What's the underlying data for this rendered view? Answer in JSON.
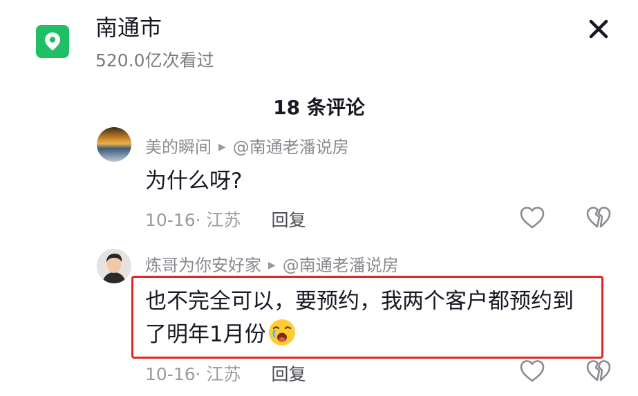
{
  "header": {
    "title": "南通市",
    "views": "520.0亿次看过"
  },
  "comments_count": "18 条评论",
  "comments": [
    {
      "author": "美的瞬间",
      "reply_to": "@南通老潘说房",
      "text": "为什么呀?",
      "date": "10-16· 江苏",
      "reply_label": "回复"
    },
    {
      "author": "炼哥为你安好家",
      "reply_to": "@南通老潘说房",
      "text": "也不完全可以，要预约，我两个客户都预约到了明年1月份",
      "date": "10-16· 江苏",
      "reply_label": "回复"
    }
  ],
  "icons": {
    "location": "location-pin-icon",
    "close": "close-icon",
    "like": "heart-outline-icon",
    "dislike": "broken-heart-icon",
    "reply_arrow": "play-arrow-icon",
    "emoji": "crying-face-emoji"
  },
  "colors": {
    "location_badge": "#1fbf66",
    "highlight_border": "#e0251e",
    "secondary_text": "#8a8b91"
  }
}
